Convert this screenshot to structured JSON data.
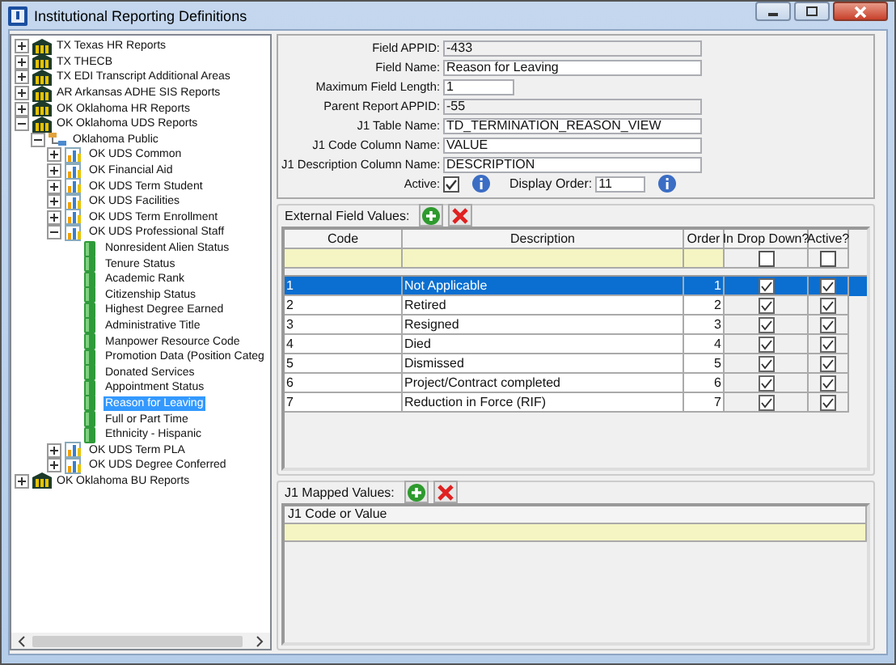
{
  "window": {
    "title": "Institutional Reporting Definitions"
  },
  "tree": [
    {
      "label": "TX Texas HR Reports",
      "kind": "bank",
      "expanded": false,
      "selected": false
    },
    {
      "label": "TX THECB",
      "kind": "bank",
      "expanded": false,
      "selected": false
    },
    {
      "label": "TX EDI Transcript Additional Areas",
      "kind": "bank",
      "expanded": false,
      "selected": false
    },
    {
      "label": "AR Arkansas ADHE SIS Reports",
      "kind": "bank",
      "expanded": false,
      "selected": false
    },
    {
      "label": "OK Oklahoma HR Reports",
      "kind": "bank",
      "expanded": false,
      "selected": false
    },
    {
      "label": "OK Oklahoma UDS Reports",
      "kind": "bank",
      "expanded": true,
      "selected": false,
      "children": [
        {
          "label": "Oklahoma Public",
          "kind": "org",
          "expanded": true,
          "selected": false,
          "children": [
            {
              "label": "OK UDS Common",
              "kind": "chart",
              "expanded": false,
              "selected": false
            },
            {
              "label": "OK Financial Aid",
              "kind": "chart",
              "expanded": false,
              "selected": false
            },
            {
              "label": "OK UDS Term Student",
              "kind": "chart",
              "expanded": false,
              "selected": false
            },
            {
              "label": "OK UDS Facilities",
              "kind": "chart",
              "expanded": false,
              "selected": false
            },
            {
              "label": "OK UDS Term Enrollment",
              "kind": "chart",
              "expanded": false,
              "selected": false
            },
            {
              "label": "OK UDS Professional Staff",
              "kind": "chart",
              "expanded": true,
              "selected": false,
              "children": [
                {
                  "label": "Nonresident Alien Status",
                  "kind": "table",
                  "selected": false
                },
                {
                  "label": "Tenure Status",
                  "kind": "table",
                  "selected": false
                },
                {
                  "label": "Academic Rank",
                  "kind": "table",
                  "selected": false
                },
                {
                  "label": "Citizenship Status",
                  "kind": "table",
                  "selected": false
                },
                {
                  "label": "Highest Degree Earned",
                  "kind": "table",
                  "selected": false
                },
                {
                  "label": "Administrative Title",
                  "kind": "table",
                  "selected": false
                },
                {
                  "label": "Manpower Resource Code",
                  "kind": "table",
                  "selected": false
                },
                {
                  "label": "Promotion Data (Position Categ",
                  "kind": "table",
                  "selected": false
                },
                {
                  "label": "Donated Services",
                  "kind": "table",
                  "selected": false
                },
                {
                  "label": "Appointment Status",
                  "kind": "table",
                  "selected": false
                },
                {
                  "label": "Reason for Leaving",
                  "kind": "table",
                  "selected": true
                },
                {
                  "label": "Full or Part Time",
                  "kind": "table",
                  "selected": false
                },
                {
                  "label": "Ethnicity - Hispanic",
                  "kind": "table",
                  "selected": false
                }
              ]
            },
            {
              "label": "OK UDS Term PLA",
              "kind": "chart",
              "expanded": false,
              "selected": false
            },
            {
              "label": "OK UDS Degree Conferred",
              "kind": "chart",
              "expanded": false,
              "selected": false
            }
          ]
        }
      ]
    },
    {
      "label": "OK Oklahoma BU Reports",
      "kind": "bank",
      "expanded": false,
      "selected": false
    }
  ],
  "form": {
    "fields": [
      {
        "label": "Field APPID:",
        "value": "-433",
        "kind": "readonly"
      },
      {
        "label": "Field Name:",
        "value": "Reason for Leaving",
        "kind": "text"
      },
      {
        "label": "Maximum Field Length:",
        "value": "1",
        "kind": "short"
      },
      {
        "label": "Parent Report APPID:",
        "value": "-55",
        "kind": "readonly"
      },
      {
        "label": "J1 Table Name:",
        "value": "TD_TERMINATION_REASON_VIEW",
        "kind": "text"
      },
      {
        "label": "J1 Code Column Name:",
        "value": "VALUE",
        "kind": "text"
      },
      {
        "label": "J1 Description Column Name:",
        "value": "DESCRIPTION",
        "kind": "text"
      }
    ],
    "active": {
      "label": "Active:",
      "checked": true
    },
    "display_order": {
      "label": "Display Order:",
      "value": "11"
    }
  },
  "external_values": {
    "label": "External Field Values:",
    "columns": [
      "Code",
      "Description",
      "Order",
      "In Drop Down?",
      "Active?"
    ],
    "filter_row": {
      "in_drop_down": false,
      "active": false
    },
    "rows": [
      {
        "code": "1",
        "description": "Not Applicable",
        "order": "1",
        "in_drop_down": true,
        "active": true,
        "selected": true
      },
      {
        "code": "2",
        "description": "Retired",
        "order": "2",
        "in_drop_down": true,
        "active": true,
        "selected": false
      },
      {
        "code": "3",
        "description": "Resigned",
        "order": "3",
        "in_drop_down": true,
        "active": true,
        "selected": false
      },
      {
        "code": "4",
        "description": "Died",
        "order": "4",
        "in_drop_down": true,
        "active": true,
        "selected": false
      },
      {
        "code": "5",
        "description": "Dismissed",
        "order": "5",
        "in_drop_down": true,
        "active": true,
        "selected": false
      },
      {
        "code": "6",
        "description": "Project/Contract completed",
        "order": "6",
        "in_drop_down": true,
        "active": true,
        "selected": false
      },
      {
        "code": "7",
        "description": "Reduction in Force (RIF)",
        "order": "7",
        "in_drop_down": true,
        "active": true,
        "selected": false
      }
    ]
  },
  "mapped_values": {
    "label": "J1 Mapped Values:",
    "columns": [
      "J1  Code or Value"
    ]
  }
}
